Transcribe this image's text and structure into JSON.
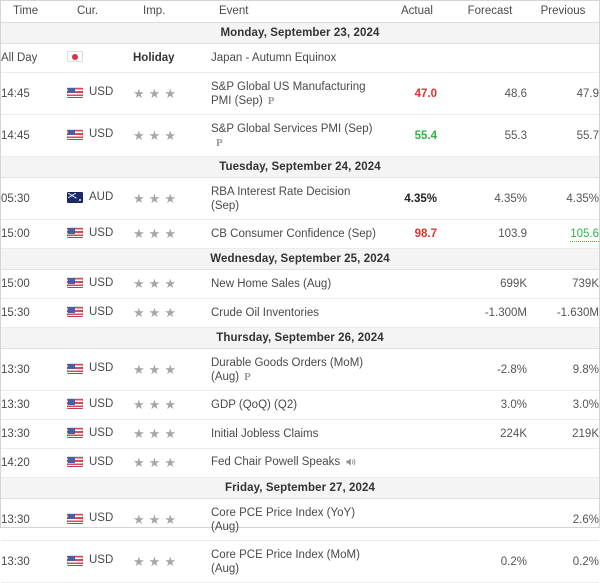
{
  "colors": {
    "negative": "#e03131",
    "positive": "#2fb344",
    "neutral": "#555555",
    "day_header_bg": "#f4f4f4"
  },
  "header": {
    "time": "Time",
    "currency": "Cur.",
    "importance": "Imp.",
    "event": "Event",
    "actual": "Actual",
    "forecast": "Forecast",
    "previous": "Previous"
  },
  "sections": [
    {
      "date": "Monday, September 23, 2024",
      "rows": [
        {
          "time": "All Day",
          "currency": "",
          "flag": "jp",
          "importance_text": "Holiday",
          "stars": 0,
          "event": "Japan - Autumn Equinox",
          "event_line2": "",
          "prelim": false,
          "speaker": false,
          "actual": "",
          "actual_state": "none",
          "forecast": "",
          "previous": "",
          "previous_state": "none"
        },
        {
          "time": "14:45",
          "currency": "USD",
          "flag": "us",
          "importance_text": "",
          "stars": 3,
          "event": "S&P Global US Manufacturing",
          "event_line2": "PMI (Sep)",
          "prelim": true,
          "speaker": false,
          "actual": "47.0",
          "actual_state": "negative",
          "forecast": "48.6",
          "previous": "47.9",
          "previous_state": "none"
        },
        {
          "time": "14:45",
          "currency": "USD",
          "flag": "us",
          "importance_text": "",
          "stars": 3,
          "event": "S&P Global Services PMI (Sep)",
          "event_line2": "",
          "prelim": true,
          "prelim_on_line2": true,
          "speaker": false,
          "actual": "55.4",
          "actual_state": "positive",
          "forecast": "55.3",
          "previous": "55.7",
          "previous_state": "none"
        }
      ]
    },
    {
      "date": "Tuesday, September 24, 2024",
      "rows": [
        {
          "time": "05:30",
          "currency": "AUD",
          "flag": "au",
          "importance_text": "",
          "stars": 3,
          "event": "RBA Interest Rate Decision",
          "event_line2": "(Sep)",
          "prelim": false,
          "speaker": false,
          "actual": "4.35%",
          "actual_state": "bold",
          "forecast": "4.35%",
          "previous": "4.35%",
          "previous_state": "none"
        },
        {
          "time": "15:00",
          "currency": "USD",
          "flag": "us",
          "importance_text": "",
          "stars": 3,
          "event": "CB Consumer Confidence (Sep)",
          "event_line2": "",
          "prelim": false,
          "speaker": false,
          "actual": "98.7",
          "actual_state": "negative",
          "forecast": "103.9",
          "previous": "105.6",
          "previous_state": "positive-underline"
        }
      ]
    },
    {
      "date": "Wednesday, September 25, 2024",
      "rows": [
        {
          "time": "15:00",
          "currency": "USD",
          "flag": "us",
          "importance_text": "",
          "stars": 3,
          "event": "New Home Sales (Aug)",
          "event_line2": "",
          "prelim": false,
          "speaker": false,
          "actual": "",
          "actual_state": "none",
          "forecast": "699K",
          "previous": "739K",
          "previous_state": "none"
        },
        {
          "time": "15:30",
          "currency": "USD",
          "flag": "us",
          "importance_text": "",
          "stars": 3,
          "event": "Crude Oil Inventories",
          "event_line2": "",
          "prelim": false,
          "speaker": false,
          "actual": "",
          "actual_state": "none",
          "forecast": "-1.300M",
          "previous": "-1.630M",
          "previous_state": "none"
        }
      ]
    },
    {
      "date": "Thursday, September 26, 2024",
      "rows": [
        {
          "time": "13:30",
          "currency": "USD",
          "flag": "us",
          "importance_text": "",
          "stars": 3,
          "event": "Durable Goods Orders (MoM)",
          "event_line2": "(Aug)",
          "prelim": true,
          "prelim_on_line2": true,
          "speaker": false,
          "actual": "",
          "actual_state": "none",
          "forecast": "-2.8%",
          "previous": "9.8%",
          "previous_state": "none"
        },
        {
          "time": "13:30",
          "currency": "USD",
          "flag": "us",
          "importance_text": "",
          "stars": 3,
          "event": "GDP (QoQ) (Q2)",
          "event_line2": "",
          "prelim": false,
          "speaker": false,
          "actual": "",
          "actual_state": "none",
          "forecast": "3.0%",
          "previous": "3.0%",
          "previous_state": "none"
        },
        {
          "time": "13:30",
          "currency": "USD",
          "flag": "us",
          "importance_text": "",
          "stars": 3,
          "event": "Initial Jobless Claims",
          "event_line2": "",
          "prelim": false,
          "speaker": false,
          "actual": "",
          "actual_state": "none",
          "forecast": "224K",
          "previous": "219K",
          "previous_state": "none"
        },
        {
          "time": "14:20",
          "currency": "USD",
          "flag": "us",
          "importance_text": "",
          "stars": 3,
          "event": "Fed Chair Powell Speaks",
          "event_line2": "",
          "prelim": false,
          "speaker": true,
          "actual": "",
          "actual_state": "none",
          "forecast": "",
          "previous": "",
          "previous_state": "none"
        }
      ]
    },
    {
      "date": "Friday, September 27, 2024",
      "rows": [
        {
          "time": "13:30",
          "currency": "USD",
          "flag": "us",
          "importance_text": "",
          "stars": 3,
          "event": "Core PCE Price Index (YoY)",
          "event_line2": "(Aug)",
          "prelim": false,
          "speaker": false,
          "actual": "",
          "actual_state": "none",
          "forecast": "",
          "previous": "2.6%",
          "previous_state": "none"
        },
        {
          "time": "13:30",
          "currency": "USD",
          "flag": "us",
          "importance_text": "",
          "stars": 3,
          "event": "Core PCE Price Index (MoM)",
          "event_line2": "(Aug)",
          "prelim": false,
          "speaker": false,
          "actual": "",
          "actual_state": "none",
          "forecast": "0.2%",
          "previous": "0.2%",
          "previous_state": "none"
        }
      ]
    }
  ]
}
